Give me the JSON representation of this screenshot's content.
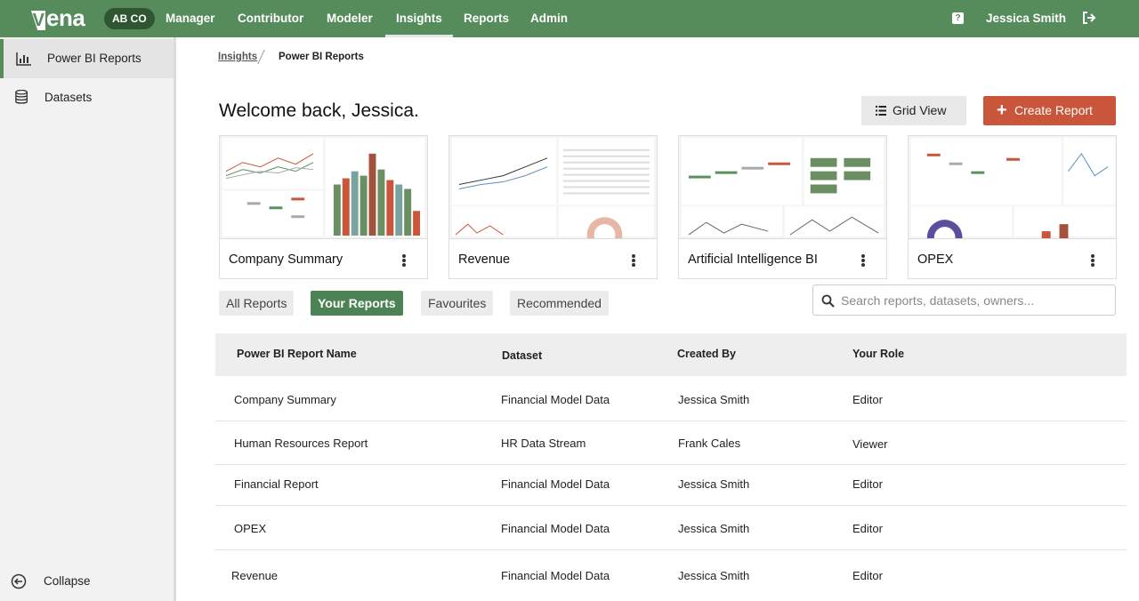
{
  "app": {
    "logo": "ena",
    "org_badge": "AB CO",
    "nav": [
      "Manager",
      "Contributor",
      "Modeler",
      "Insights",
      "Reports",
      "Admin"
    ],
    "active_nav": "Insights",
    "help": "?",
    "user": "Jessica Smith"
  },
  "sidebar": {
    "items": [
      {
        "label": "Power BI Reports",
        "icon": "bar-chart-icon"
      },
      {
        "label": "Datasets",
        "icon": "database-icon"
      }
    ],
    "collapse": "Collapse"
  },
  "breadcrumb": {
    "parent": "Insights",
    "current": "Power BI Reports"
  },
  "welcome": "Welcome back, Jessica.",
  "buttons": {
    "grid_view": "Grid View",
    "create_report": "Create Report",
    "create_icon": "+"
  },
  "cards": [
    {
      "title": "Company Summary"
    },
    {
      "title": "Revenue"
    },
    {
      "title": "Artificial Intelligence BI"
    },
    {
      "title": "OPEX"
    }
  ],
  "filters": [
    "All Reports",
    "Your Reports",
    "Favourites",
    "Recommended"
  ],
  "active_filter": "Your Reports",
  "search": {
    "placeholder": "Search reports, datasets, owners..."
  },
  "table": {
    "headers": [
      "Power BI Report Name",
      "Dataset",
      "Created By",
      "Your Role"
    ],
    "rows": [
      [
        "Company Summary",
        "Financial Model Data",
        "Jessica Smith",
        "Editor"
      ],
      [
        "Human Resources Report",
        "HR Data Stream",
        "Frank Cales",
        "Viewer"
      ],
      [
        "Financial Report",
        "Financial Model Data",
        "Jessica Smith",
        "Editor"
      ],
      [
        "OPEX",
        "Financial Model Data",
        "Jessica Smith",
        "Editor"
      ],
      [
        "Revenue",
        "Financial Model Data",
        "Jessica Smith",
        "Editor"
      ]
    ]
  },
  "colors": {
    "brand_green": "#568b5c",
    "accent_orange": "#c9553a",
    "dark_badge": "#2f5533"
  }
}
